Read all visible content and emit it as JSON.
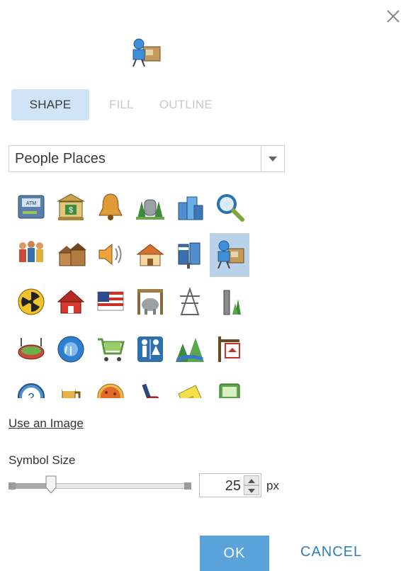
{
  "dialog": {
    "close_icon": "close-icon",
    "preview_icon": "office-desk-icon"
  },
  "tabs": [
    {
      "label": "SHAPE",
      "active": true
    },
    {
      "label": "FILL",
      "active": false
    },
    {
      "label": "OUTLINE",
      "active": false
    }
  ],
  "category": {
    "selected": "People Places",
    "dropdown_icon": "triangle-down-icon"
  },
  "symbols": [
    {
      "icon": "atm-icon"
    },
    {
      "icon": "bank-icon"
    },
    {
      "icon": "bell-icon"
    },
    {
      "icon": "cemetery-icon"
    },
    {
      "icon": "city-buildings-icon"
    },
    {
      "icon": "magnifier-icon"
    },
    {
      "icon": "people-crowd-icon"
    },
    {
      "icon": "houses-icon"
    },
    {
      "icon": "speaker-icon"
    },
    {
      "icon": "home-icon"
    },
    {
      "icon": "mailbox-icon"
    },
    {
      "icon": "office-desk-icon",
      "selected": true
    },
    {
      "icon": "radiation-icon"
    },
    {
      "icon": "school-house-icon"
    },
    {
      "icon": "us-flag-icon"
    },
    {
      "icon": "zoo-elephant-icon"
    },
    {
      "icon": "power-tower-icon"
    },
    {
      "icon": "tower-tree-icon"
    },
    {
      "icon": "stadium-icon"
    },
    {
      "icon": "shower-icon"
    },
    {
      "icon": "shopping-cart-icon"
    },
    {
      "icon": "restroom-icon"
    },
    {
      "icon": "river-landscape-icon"
    },
    {
      "icon": "real-estate-sign-icon"
    },
    {
      "icon": "help-icon"
    },
    {
      "icon": "beer-mug-icon"
    },
    {
      "icon": "pizza-icon"
    },
    {
      "icon": "fire-hydrant-icon"
    },
    {
      "icon": "sticky-note-icon"
    },
    {
      "icon": "computer-sign-icon"
    }
  ],
  "use_image_link": "Use an Image",
  "symbol_size": {
    "label": "Symbol Size",
    "value": "25",
    "unit": "px",
    "slider_fraction": 0.23
  },
  "buttons": {
    "ok": "OK",
    "cancel": "CANCEL"
  },
  "colors": {
    "tab_active_bg": "#cfe4f7",
    "selected_cell_bg": "#b9d2ea",
    "ok_button_bg": "#5aa3db",
    "cancel_text": "#2f7dbd"
  }
}
